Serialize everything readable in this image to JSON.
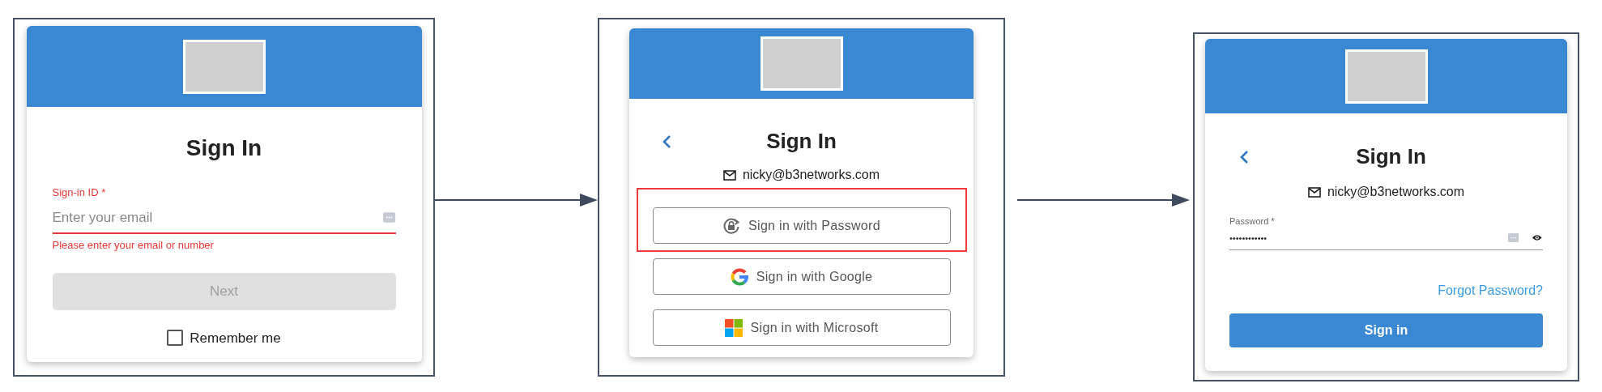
{
  "panels": [
    {
      "kind": "id_entry",
      "title": "Sign In",
      "field": {
        "label": "Sign-in ID *",
        "placeholder": "Enter your email",
        "invalid": true,
        "error": "Please enter your email or number"
      },
      "next_button": {
        "label": "Next",
        "disabled": true
      },
      "remember": {
        "label": "Remember me",
        "checked": false
      }
    },
    {
      "kind": "method_choice",
      "title": "Sign In",
      "email": "nicky@b3networks.com",
      "options": [
        {
          "kind": "password",
          "label": "Sign in with Password",
          "highlighted": true
        },
        {
          "kind": "google",
          "label": "Sign in with Google",
          "highlighted": false
        },
        {
          "kind": "microsoft",
          "label": "Sign in with Microsoft",
          "highlighted": false
        }
      ]
    },
    {
      "kind": "password",
      "title": "Sign In",
      "email": "nicky@b3networks.com",
      "field": {
        "label": "Password *",
        "value": "••••••••••••"
      },
      "forgot_link": "Forgot Password?",
      "submit_button": {
        "label": "Sign in",
        "disabled": false
      }
    }
  ]
}
